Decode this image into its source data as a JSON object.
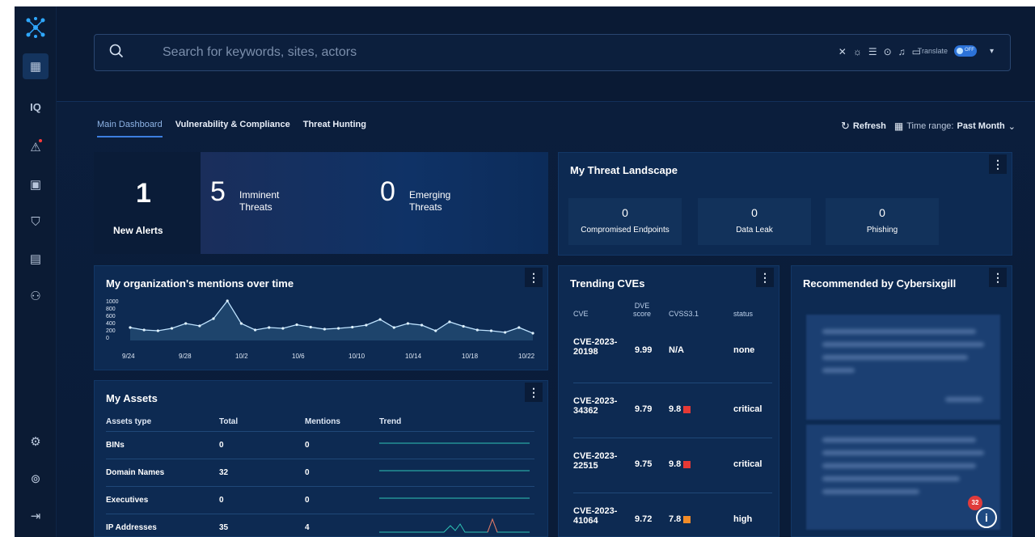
{
  "search": {
    "placeholder": "Search for keywords, sites, actors",
    "translate_label": "Translate",
    "toggle_state": "OFF"
  },
  "tabs": [
    {
      "label": "Main Dashboard",
      "active": true
    },
    {
      "label": "Vulnerability & Compliance",
      "active": false
    },
    {
      "label": "Threat Hunting",
      "active": false
    }
  ],
  "actions": {
    "refresh": "Refresh",
    "time_range_label": "Time range:",
    "time_range_value": "Past Month"
  },
  "stats": {
    "new_alerts": {
      "value": "1",
      "label": "New Alerts"
    },
    "imminent": {
      "value": "5",
      "label": "Imminent Threats"
    },
    "emerging": {
      "value": "0",
      "label": "Emerging Threats"
    }
  },
  "landscape": {
    "title": "My Threat Landscape",
    "tiles": [
      {
        "value": "0",
        "label": "Compromised Endpoints"
      },
      {
        "value": "0",
        "label": "Data Leak"
      },
      {
        "value": "0",
        "label": "Phishing"
      }
    ]
  },
  "mentions": {
    "title": "My organization's mentions over time",
    "y_ticks": [
      "1000",
      "800",
      "600",
      "400",
      "200",
      "0"
    ],
    "x_ticks": [
      "9/24",
      "9/28",
      "10/2",
      "10/6",
      "10/10",
      "10/14",
      "10/18",
      "10/22"
    ]
  },
  "chart_data": {
    "type": "line",
    "title": "My organization's mentions over time",
    "x": [
      "9/24",
      "9/25",
      "9/26",
      "9/27",
      "9/28",
      "9/29",
      "9/30",
      "10/1",
      "10/2",
      "10/3",
      "10/4",
      "10/5",
      "10/6",
      "10/7",
      "10/8",
      "10/9",
      "10/10",
      "10/11",
      "10/12",
      "10/13",
      "10/14",
      "10/15",
      "10/16",
      "10/17",
      "10/18",
      "10/19",
      "10/20",
      "10/21",
      "10/22",
      "10/23"
    ],
    "values": [
      320,
      260,
      240,
      300,
      420,
      360,
      540,
      980,
      420,
      260,
      320,
      300,
      390,
      330,
      280,
      300,
      330,
      380,
      520,
      320,
      420,
      380,
      240,
      460,
      350,
      260,
      240,
      200,
      320,
      180
    ],
    "ylim": [
      0,
      1000
    ],
    "grid": false,
    "fill": true
  },
  "assets": {
    "title": "My Assets",
    "headers": [
      "Assets type",
      "Total",
      "Mentions",
      "Trend"
    ],
    "rows": [
      {
        "type": "BINs",
        "total": "0",
        "mentions": "0"
      },
      {
        "type": "Domain Names",
        "total": "32",
        "mentions": "0"
      },
      {
        "type": "Executives",
        "total": "0",
        "mentions": "0"
      },
      {
        "type": "IP Addresses",
        "total": "35",
        "mentions": "4"
      }
    ]
  },
  "cves": {
    "title": "Trending CVEs",
    "headers": [
      "CVE",
      "DVE score",
      "CVSS3.1",
      "status"
    ],
    "rows": [
      {
        "id": "CVE-2023-20198",
        "dve": "9.99",
        "cvss": "N/A",
        "status": "none",
        "color": ""
      },
      {
        "id": "CVE-2023-34362",
        "dve": "9.79",
        "cvss": "9.8",
        "status": "critical",
        "color": "#e53935"
      },
      {
        "id": "CVE-2023-22515",
        "dve": "9.75",
        "cvss": "9.8",
        "status": "critical",
        "color": "#e53935"
      },
      {
        "id": "CVE-2023-41064",
        "dve": "9.72",
        "cvss": "7.8",
        "status": "high",
        "color": "#f28c28"
      }
    ]
  },
  "recommended": {
    "title": "Recommended by Cybersixgill"
  },
  "help": {
    "badge_count": "32",
    "icon_glyph": "i"
  },
  "colors": {
    "accent": "#3c7ee0",
    "critical": "#e53935",
    "high": "#f28c28"
  }
}
